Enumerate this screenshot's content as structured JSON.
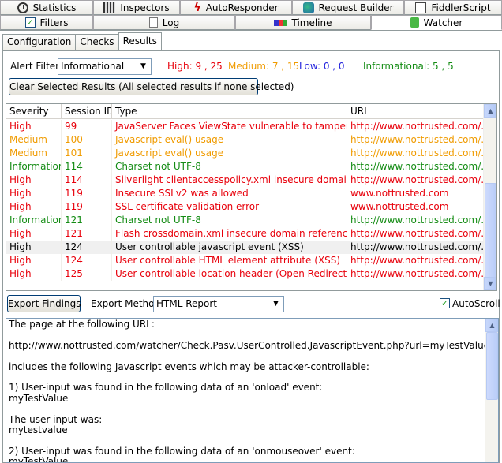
{
  "top_tabs": [
    {
      "label": "Statistics",
      "icon": "stopwatch-icon"
    },
    {
      "label": "Inspectors",
      "icon": "inspectors-icon"
    },
    {
      "label": "AutoResponder",
      "icon": "lightning-icon"
    },
    {
      "label": "Request Builder",
      "icon": "request-builder-icon"
    },
    {
      "label": "FiddlerScript",
      "icon": "script-icon"
    }
  ],
  "second_tabs": [
    {
      "label": "Filters",
      "icon": "checkbox-icon"
    },
    {
      "label": "Log",
      "icon": "log-icon"
    },
    {
      "label": "Timeline",
      "icon": "timeline-icon"
    },
    {
      "label": "Watcher",
      "icon": "watcher-icon",
      "active": true
    }
  ],
  "sub_tabs": [
    {
      "label": "Configuration"
    },
    {
      "label": "Checks"
    },
    {
      "label": "Results",
      "active": true
    }
  ],
  "alert_filter": {
    "label": "Alert Filter:",
    "value": "Informational",
    "counts": {
      "high": "High: 9 , 25",
      "medium": "Medium: 7 , 15",
      "low": "Low: 0 , 0",
      "informational": "Informational: 5 , 5"
    }
  },
  "clear_button": "Clear Selected Results (All selected results if none selected)",
  "columns": [
    "Severity",
    "Session ID",
    "Type",
    "URL"
  ],
  "severity_colors": {
    "High": "#e8000b",
    "Medium": "#f09b00",
    "Informational": "#148c14",
    "Normal": "#000000"
  },
  "rows": [
    {
      "severity": "High",
      "session": "99",
      "type": "JavaServer Faces ViewState vulnerable to tampering",
      "url": "http://www.nottrusted.com/..."
    },
    {
      "severity": "Medium",
      "session": "100",
      "type": "Javascript eval() usage",
      "url": "http://www.nottrusted.com/..."
    },
    {
      "severity": "Medium",
      "session": "101",
      "type": "Javascript eval() usage",
      "url": "http://www.nottrusted.com/..."
    },
    {
      "severity": "Informational",
      "session": "114",
      "type": "Charset not UTF-8",
      "url": "http://www.nottrusted.com/..."
    },
    {
      "severity": "High",
      "session": "114",
      "type": "Silverlight clientaccesspolicy.xml insecure domain reference",
      "url": "http://www.nottrusted.com/..."
    },
    {
      "severity": "High",
      "session": "119",
      "type": "Insecure SSLv2 was allowed",
      "url": "www.nottrusted.com"
    },
    {
      "severity": "High",
      "session": "119",
      "type": "SSL certificate validation error",
      "url": "www.nottrusted.com"
    },
    {
      "severity": "Informational",
      "session": "121",
      "type": "Charset not UTF-8",
      "url": "http://www.nottrusted.com/..."
    },
    {
      "severity": "High",
      "session": "121",
      "type": "Flash crossdomain.xml insecure domain reference",
      "url": "http://www.nottrusted.com/..."
    },
    {
      "severity": "High",
      "session": "124",
      "type": "User controllable javascript event (XSS)",
      "url": "http://www.nottrusted.com/...",
      "selected": true
    },
    {
      "severity": "High",
      "session": "124",
      "type": "User controllable HTML element attribute (XSS)",
      "url": "http://www.nottrusted.com/..."
    },
    {
      "severity": "High",
      "session": "125",
      "type": "User controllable location header (Open Redirect)",
      "url": "http://www.nottrusted.com/..."
    }
  ],
  "export": {
    "button": "Export Findings",
    "method_label": "Export Method:",
    "method_value": "HTML Report",
    "autoscroll_label": "AutoScroll",
    "autoscroll_checked": true
  },
  "details_lines": [
    "The page at the following URL:",
    "",
    "http://www.nottrusted.com/watcher/Check.Pasv.UserControlled.JavascriptEvent.php?url=myTestValue",
    "",
    "includes the following Javascript events which may be attacker-controllable:",
    "",
    "1) User-input was found in the following data of an 'onload' event:",
    "myTestValue",
    "",
    "The user input was:",
    "mytestvalue",
    "",
    "2) User-input was found in the following data of an 'onmouseover' event:",
    "myTestValue"
  ]
}
